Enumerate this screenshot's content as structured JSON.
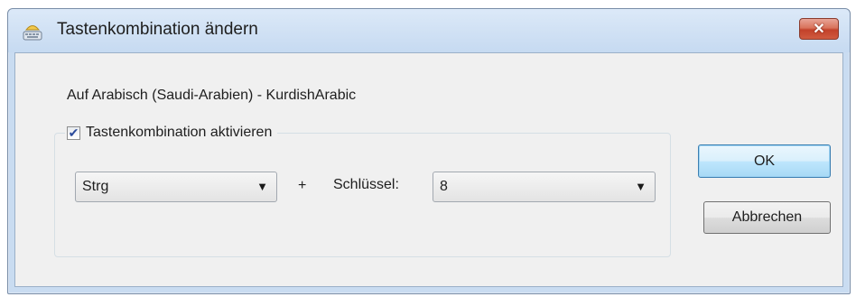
{
  "window": {
    "title": "Tastenkombination ändern",
    "close_label": "✕"
  },
  "dialog": {
    "language_label": "Auf Arabisch (Saudi-Arabien) - KurdishArabic",
    "enable_checkbox": {
      "label": "Tastenkombination aktivieren",
      "checked": true
    },
    "modifier_combo": {
      "value": "Strg"
    },
    "plus": "+",
    "key_label": "Schlüssel:",
    "key_combo": {
      "value": "8"
    },
    "ok_label": "OK",
    "cancel_label": "Abbrechen"
  },
  "icons": {
    "app": "keyboard-icon",
    "close": "close-icon",
    "dropdown": "chevron-down-icon"
  },
  "colors": {
    "close_button": "#c7452e",
    "window_frame": "#c9dcf1",
    "client_bg": "#f0f0f0",
    "ok_focus": "#3c7fb1"
  }
}
